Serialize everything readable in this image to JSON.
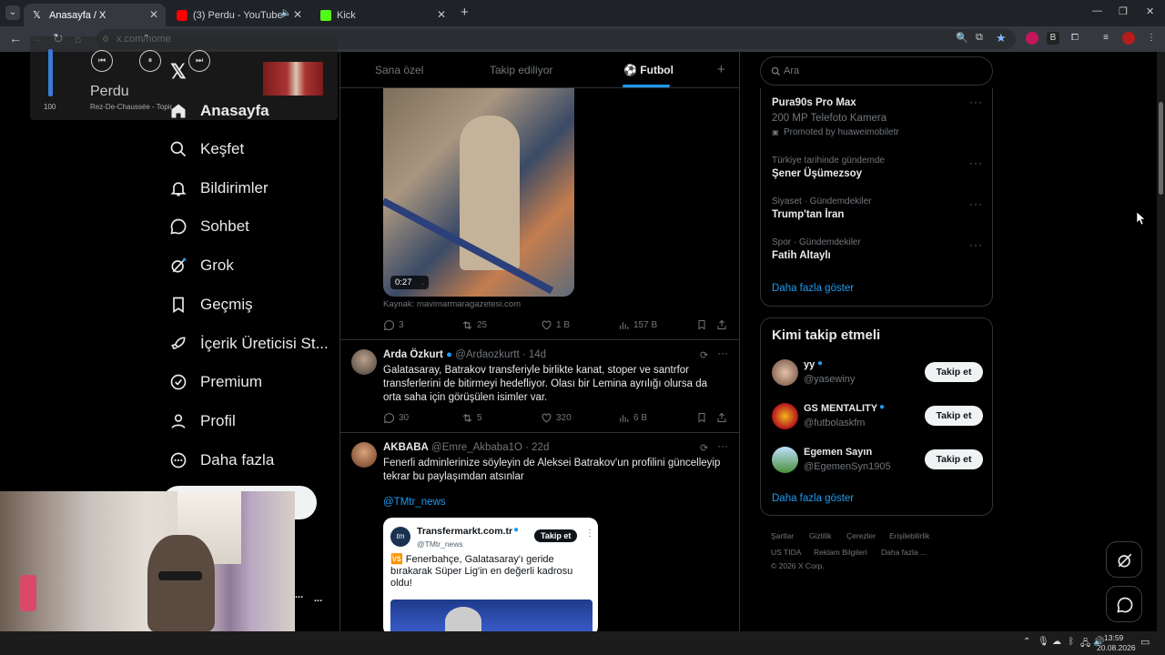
{
  "browser": {
    "tabs": [
      {
        "label": "Anasayfa / X",
        "active": true
      },
      {
        "label": "(3) Perdu - YouTube",
        "active": false
      },
      {
        "label": "Kick",
        "active": false
      }
    ],
    "url": "x.com/home",
    "new_tab": "+"
  },
  "media_overlay": {
    "volume": "100",
    "track": "Perdu",
    "artist": "Rez-De-Chaussée - Topic"
  },
  "nav": {
    "items": [
      {
        "label": "Anasayfa",
        "icon": "home-icon"
      },
      {
        "label": "Keşfet",
        "icon": "search-icon"
      },
      {
        "label": "Bildirimler",
        "icon": "bell-icon"
      },
      {
        "label": "Sohbet",
        "icon": "chat-icon"
      },
      {
        "label": "Grok",
        "icon": "grok-icon"
      },
      {
        "label": "Geçmiş",
        "icon": "bookmark-icon"
      },
      {
        "label": "İçerik Üreticisi St...",
        "icon": "rocket-icon"
      },
      {
        "label": "Premium",
        "icon": "verified-icon"
      },
      {
        "label": "Profil",
        "icon": "person-icon"
      },
      {
        "label": "Daha fazla",
        "icon": "more-circle-icon"
      }
    ],
    "more_dots": "...",
    "more_dots_2": "..."
  },
  "feed": {
    "tabs": [
      "Sana özel",
      "Takip ediliyor",
      "Futbol"
    ],
    "add_tab": "+",
    "video_time": "0:27",
    "source": "Kaynak: mavimarmaragazetesi.com",
    "first_actions": {
      "replies": "3",
      "reposts": "25",
      "likes": "1 B",
      "views": "157 B"
    },
    "tweet2": {
      "name": "Arda Özkurt",
      "handle": "@Ardaozkurtt · 14d",
      "text": "Galatasaray, Batrakov transferiyle birlikte kanat, stoper ve santrfor transferlerini de bitirmeyi hedefliyor. Olası bir Lemina ayrılığı olursa da orta saha için görüşülen isimler var.",
      "replies": "30",
      "reposts": "5",
      "likes": "320",
      "views": "6 B"
    },
    "tweet3": {
      "name": "AKBABA",
      "handle": "@Emre_Akbaba1O · 22d",
      "text": "Fenerli adminlerinize söyleyin de Aleksei Batrakov'un profilini güncelleyip tekrar bu paylaşımdan atsınlar",
      "mention": "@TMtr_news",
      "quote": {
        "name": "Transfermarkt.com.tr",
        "handle": "@TMtr_news",
        "follow": "Takip et",
        "text": "🆚 Fenerbahçe, Galatasaray'ı geride bırakarak Süper Lig'in en değerli kadrosu oldu!"
      }
    }
  },
  "sidebar": {
    "search_placeholder": "Ara",
    "trends": [
      {
        "meta": "",
        "name": "Pura90s Pro Max",
        "sub": "200 MP Telefoto Kamera",
        "promo": "Promoted by huaweimobiletr"
      },
      {
        "meta": "Türkiye tarihinde gündemde",
        "name": "Şener Üşümezsoy"
      },
      {
        "meta": "Siyaset · Gündemdekiler",
        "name": "Trump'tan İran"
      },
      {
        "meta": "Spor · Gündemdekiler",
        "name": "Fatih Altaylı"
      }
    ],
    "show_more": "Daha fazla göster",
    "who_to_follow_title": "Kimi takip etmeli",
    "who_to_follow": [
      {
        "name": "yy",
        "handle": "@yasewiny",
        "button": "Takip et"
      },
      {
        "name": "GS MENTALITY",
        "handle": "@futbolaskfm",
        "button": "Takip et"
      },
      {
        "name": "Egemen Sayın",
        "handle": "@EgemenSyn1905",
        "button": "Takip et"
      }
    ],
    "show_more_2": "Daha fazla göster",
    "footer": [
      "Şartlar",
      "Gizlilik",
      "Çerezler",
      "Erişilebilirlik",
      "US TIDA",
      "Reklam Bilgileri",
      "Daha fazla ...",
      "© 2026 X Corp."
    ]
  },
  "taskbar": {
    "time": "13:59",
    "date": "20.08.2026"
  },
  "colors": {
    "accent": "#1d9bf0",
    "bg": "#000000",
    "border": "#2f3336"
  }
}
